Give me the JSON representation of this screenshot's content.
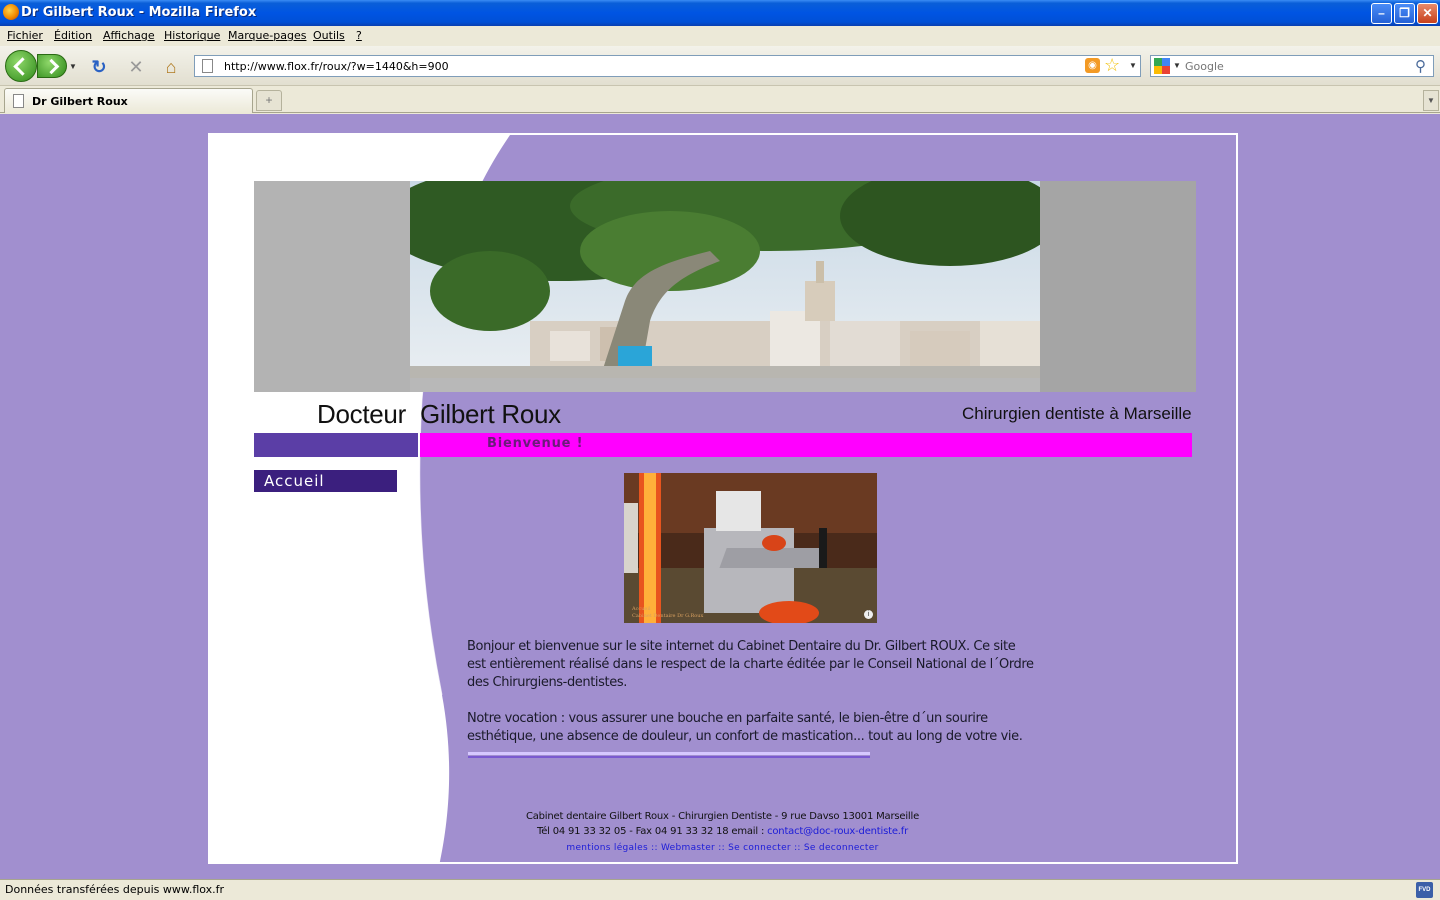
{
  "window": {
    "title": "Dr Gilbert Roux - Mozilla Firefox"
  },
  "menu": {
    "items": [
      "Fichier",
      "Édition",
      "Affichage",
      "Historique",
      "Marque-pages",
      "Outils",
      "?"
    ]
  },
  "toolbar": {
    "url": "http://www.flox.fr/roux/?w=1440&h=900",
    "search_placeholder": "Google"
  },
  "tabs": [
    {
      "label": "Dr Gilbert Roux"
    }
  ],
  "site": {
    "title_first": "Docteur",
    "title_name": "Gilbert Roux",
    "subtitle": "Chirurgien dentiste à Marseille",
    "welcome": "Bienvenue !",
    "nav": [
      "Accueil"
    ],
    "photo_caption": [
      "Accueil",
      "Cabinet Dentaire Dr G.Roux"
    ],
    "intro": [
      "Bonjour et bienvenue sur le site internet du Cabinet Dentaire du Dr. Gilbert ROUX. Ce site est entièrement réalisé dans le respect de la charte éditée par le Conseil National de l´Ordre des Chirurgiens-dentistes.",
      "Notre vocation : vous assurer une bouche en parfaite santé, le bien-être d´un sourire esthétique, une absence de douleur, un confort de mastication... tout au long de votre vie."
    ],
    "footer": {
      "line1": "Cabinet dentaire Gilbert Roux - Chirurgien Dentiste - 9 rue Davso 13001 Marseille",
      "line2_prefix": "Tél 04 91 33 32 05 - Fax 04 91 33 32 18 email :",
      "email": "contact@doc-roux-dentiste.fr",
      "links": [
        "mentions légales",
        "Webmaster",
        "Se connecter",
        "Se deconnecter"
      ],
      "separator": "::"
    }
  },
  "status": {
    "text": "Données transférées depuis www.flox.fr"
  },
  "colors": {
    "page_bg": "#a18fcf",
    "bienvenue_bar": "#ff00ff",
    "nav_bar": "#3b1f7e",
    "left_bar": "#5b3ea6",
    "link": "#1c1cd8"
  }
}
